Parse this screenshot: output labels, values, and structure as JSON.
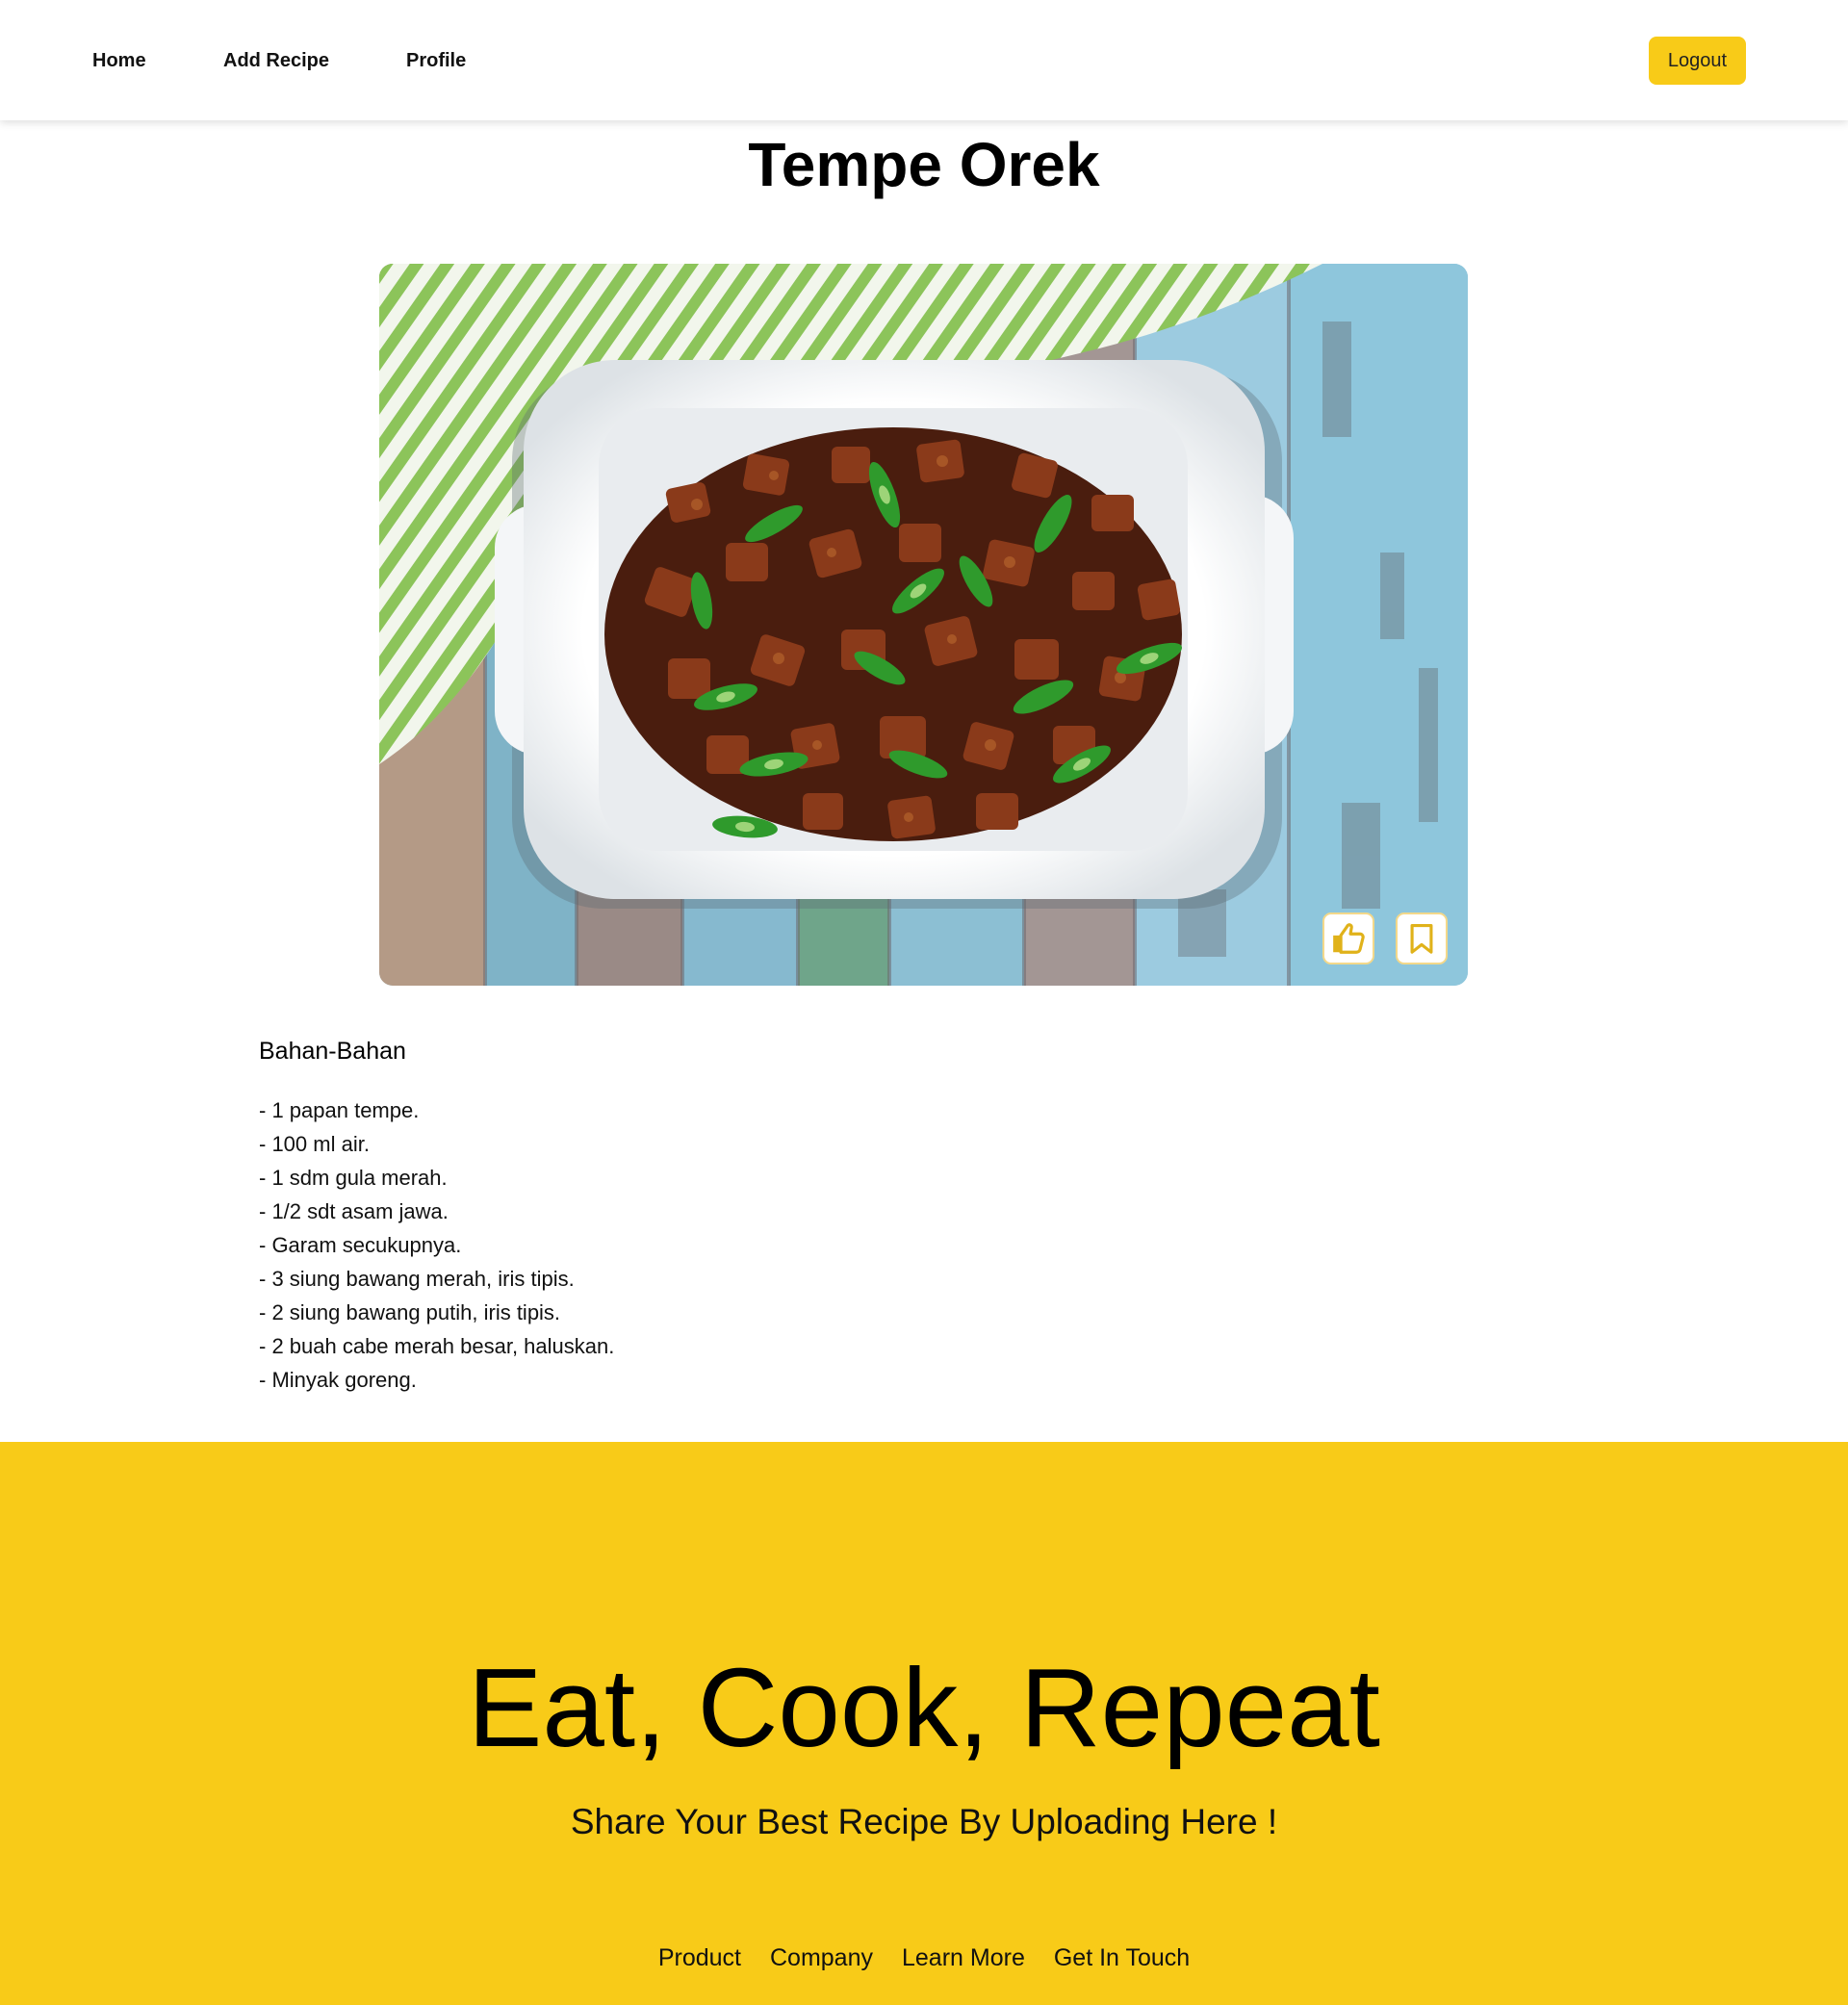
{
  "nav": {
    "home": "Home",
    "add_recipe": "Add Recipe",
    "profile": "Profile",
    "logout": "Logout"
  },
  "recipe": {
    "title": "Tempe Orek",
    "image_icon": "recipe-photo",
    "like_icon": "thumbs-up-icon",
    "bookmark_icon": "bookmark-icon",
    "ingredients_heading": "Bahan-Bahan",
    "ingredients": [
      "- 1 papan tempe.",
      "- 100 ml air.",
      "- 1 sdm gula merah.",
      "- 1/2 sdt asam jawa.",
      "- Garam secukupnya.",
      "- 3 siung bawang merah, iris tipis.",
      "- 2 siung bawang putih, iris tipis.",
      "- 2 buah cabe merah besar, haluskan.",
      "- Minyak goreng."
    ]
  },
  "footer": {
    "tagline": "Eat, Cook, Repeat",
    "subtagline": "Share Your Best Recipe By Uploading Here !",
    "links": [
      "Product",
      "Company",
      "Learn More",
      "Get In Touch"
    ]
  },
  "colors": {
    "accent": "#f8cb18",
    "icon": "#e0b21a"
  }
}
